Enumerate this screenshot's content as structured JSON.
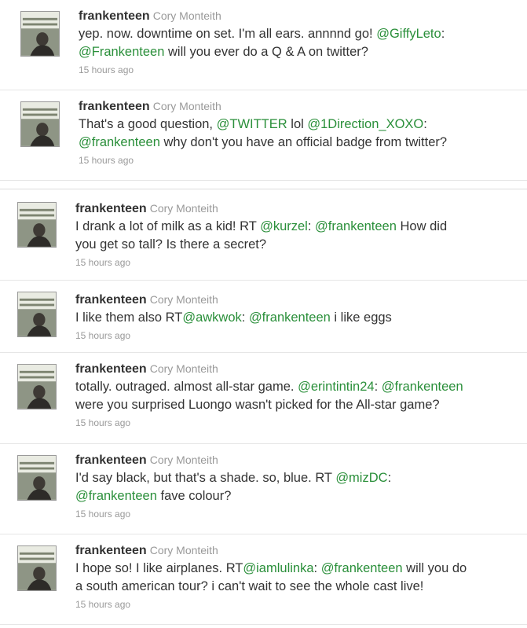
{
  "tweets": [
    {
      "screen_name": "frankenteen",
      "full_name": "Cory Monteith",
      "segments": [
        {
          "t": "yep. now. downtime on set. I'm all ears. annnnd go! "
        },
        {
          "t": "@GiffyLeto",
          "link": true
        },
        {
          "t": ":"
        },
        {
          "br": true
        },
        {
          "t": "@Frankenteen",
          "link": true
        },
        {
          "t": " will you ever do a Q & A on twitter?"
        }
      ],
      "time": "15 hours ago"
    },
    {
      "screen_name": "frankenteen",
      "full_name": "Cory Monteith",
      "segments": [
        {
          "t": "That's a good question, "
        },
        {
          "t": "@TWITTER",
          "link": true
        },
        {
          "t": " lol "
        },
        {
          "t": "@1Direction_XOXO",
          "link": true
        },
        {
          "t": ":"
        },
        {
          "br": true
        },
        {
          "t": "@frankenteen",
          "link": true
        },
        {
          "t": " why don't you have an official badge from twitter?"
        }
      ],
      "time": "15 hours ago"
    },
    {
      "screen_name": "frankenteen",
      "full_name": "Cory Monteith",
      "segments": [
        {
          "t": "I drank a lot of milk as a kid! RT "
        },
        {
          "t": "@kurzel",
          "link": true
        },
        {
          "t": ": "
        },
        {
          "t": "@frankenteen",
          "link": true
        },
        {
          "t": " How did"
        },
        {
          "br": true
        },
        {
          "t": "you get so tall? Is there a secret?"
        }
      ],
      "time": "15 hours ago"
    },
    {
      "screen_name": "frankenteen",
      "full_name": "Cory Monteith",
      "segments": [
        {
          "t": "I like them also RT"
        },
        {
          "t": "@awkwok",
          "link": true
        },
        {
          "t": ": "
        },
        {
          "t": "@frankenteen",
          "link": true
        },
        {
          "t": " i like eggs"
        }
      ],
      "time": "15 hours ago"
    },
    {
      "screen_name": "frankenteen",
      "full_name": "Cory Monteith",
      "segments": [
        {
          "t": "totally. outraged. almost all-star game. "
        },
        {
          "t": "@erintintin24",
          "link": true
        },
        {
          "t": ": "
        },
        {
          "t": "@frankenteen",
          "link": true
        },
        {
          "br": true
        },
        {
          "t": "were you surprised Luongo wasn't picked for the All-star game?"
        }
      ],
      "time": "15 hours ago"
    },
    {
      "screen_name": "frankenteen",
      "full_name": "Cory Monteith",
      "segments": [
        {
          "t": "I'd say black, but that's a shade. so, blue. RT "
        },
        {
          "t": "@mizDC",
          "link": true
        },
        {
          "t": ":"
        },
        {
          "br": true
        },
        {
          "t": "@frankenteen",
          "link": true
        },
        {
          "t": " fave colour?"
        }
      ],
      "time": "15 hours ago"
    },
    {
      "screen_name": "frankenteen",
      "full_name": "Cory Monteith",
      "segments": [
        {
          "t": "I hope so! I like airplanes. RT"
        },
        {
          "t": "@iamlulinka",
          "link": true
        },
        {
          "t": ": "
        },
        {
          "t": "@frankenteen",
          "link": true
        },
        {
          "t": " will you do"
        },
        {
          "br": true
        },
        {
          "t": "a south american tour? i can't wait to see the whole cast live!"
        }
      ],
      "time": "15 hours ago"
    }
  ],
  "colors": {
    "link": "#2a8f3a",
    "text": "#333333",
    "meta": "#999999"
  },
  "icons": {
    "avatar": "avatar-photo-icon"
  }
}
